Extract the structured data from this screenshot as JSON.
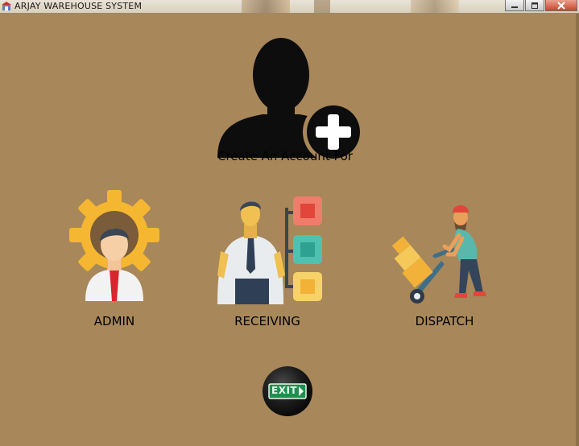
{
  "window": {
    "title": "ARJAY WAREHOUSE SYSTEM",
    "minimize_icon": "minimize-icon",
    "maximize_icon": "maximize-icon",
    "close_icon": "close-icon"
  },
  "main": {
    "heading": "Create An Account For",
    "header_icon": "add-user-icon",
    "roles": [
      {
        "label": "ADMIN",
        "icon": "admin-gear-person-icon"
      },
      {
        "label": "RECEIVING",
        "icon": "receiving-person-checklist-icon"
      },
      {
        "label": "DISPATCH",
        "icon": "dispatch-handtruck-worker-icon"
      }
    ],
    "exit_label": "EXIT"
  },
  "colors": {
    "background": "#a8875a",
    "exit_green": "#1f8f4e"
  }
}
